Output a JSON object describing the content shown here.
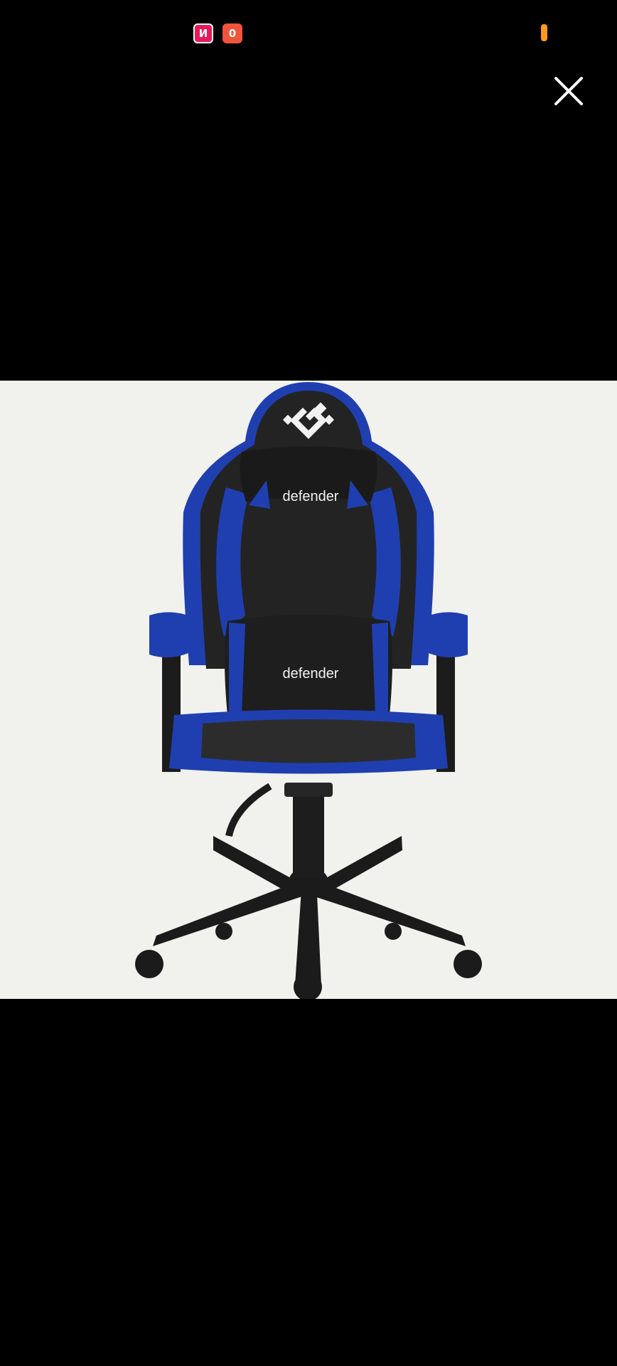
{
  "status_bar": {
    "app_icons": [
      {
        "name": "notification-app-icon-1",
        "glyph": "И",
        "color": "#e8195a"
      },
      {
        "name": "notification-app-icon-2",
        "glyph": "0",
        "color": "#f0553b"
      }
    ],
    "battery_color": "#ff9a1f"
  },
  "viewer": {
    "background": "#f1f1ee",
    "product_image": {
      "brand_text_headrest": "defender",
      "brand_text_lumbar": "defender",
      "accent_color": "#1f3fb0"
    }
  },
  "controls": {
    "close_icon": "close-icon"
  }
}
